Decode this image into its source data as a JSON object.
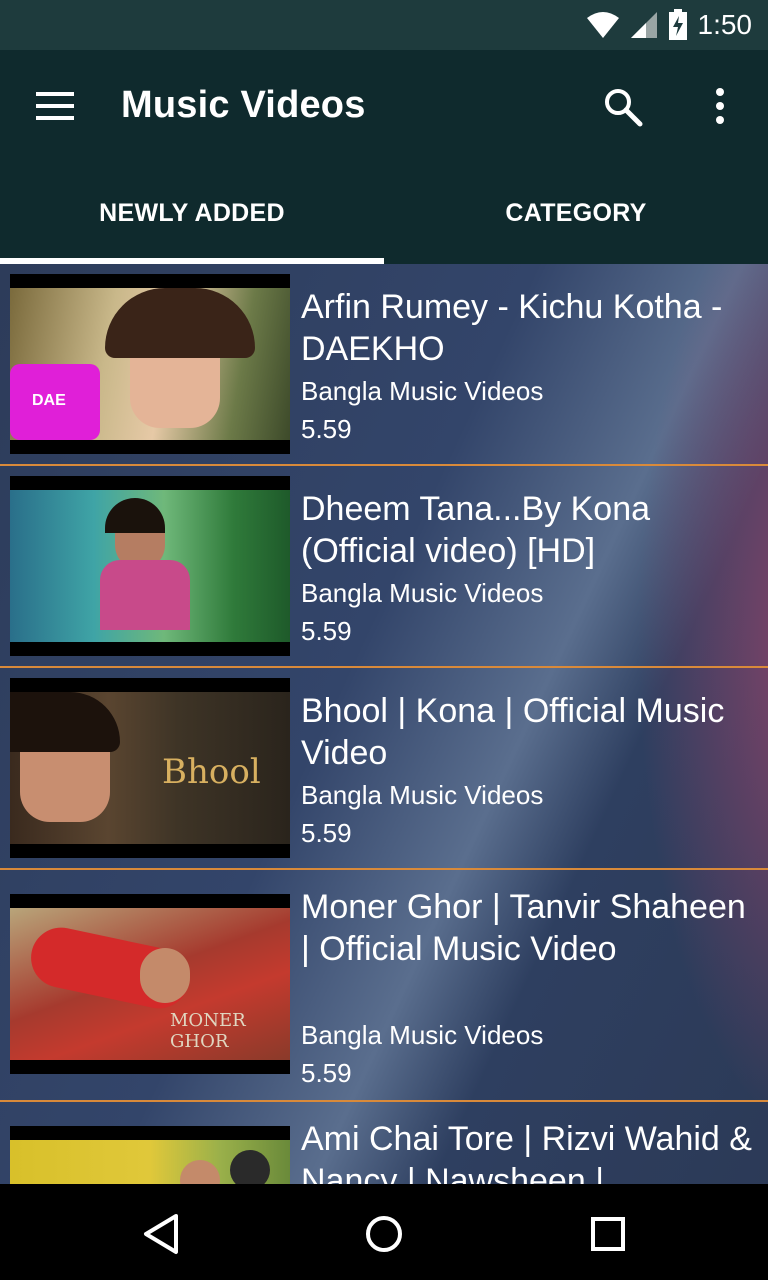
{
  "status_bar": {
    "time": "1:50",
    "icons": [
      "wifi-icon",
      "cell-signal-icon",
      "battery-charging-icon"
    ]
  },
  "app_bar": {
    "title": "Music Videos",
    "icons": [
      "menu-icon",
      "search-icon",
      "more-vert-icon"
    ]
  },
  "tabs": [
    {
      "label": "NEWLY ADDED",
      "selected": true
    },
    {
      "label": "CATEGORY",
      "selected": false
    }
  ],
  "videos": [
    {
      "title": "Arfin Rumey - Kichu Kotha - DAEKHO",
      "category": "Bangla Music Videos",
      "duration": "5.59"
    },
    {
      "title": "Dheem Tana...By Kona (Official video) [HD]",
      "category": "Bangla Music Videos",
      "duration": "5.59"
    },
    {
      "title": "Bhool | Kona | Official Music Video",
      "category": "Bangla Music Videos",
      "duration": "5.59"
    },
    {
      "title": "Moner Ghor | Tanvir Shaheen | Official Music Video",
      "category": "Bangla Music Videos",
      "duration": "5.59"
    },
    {
      "title": "Ami Chai Tore | Rizvi Wahid & Nancy | Nawsheen |",
      "category": "",
      "duration": ""
    }
  ],
  "thumbnail_text": {
    "thumb1_logo": "DAE",
    "thumb3_title": "Bhool",
    "thumb4_title": "MONER GHOR"
  },
  "colors": {
    "status_bar": "#1e3b3d",
    "app_bar": "#0f2a2d",
    "divider": "#d98a3a",
    "list_bg": "#2c3a55"
  },
  "nav_bar": {
    "icons": [
      "back-icon",
      "home-icon",
      "recents-icon"
    ]
  }
}
